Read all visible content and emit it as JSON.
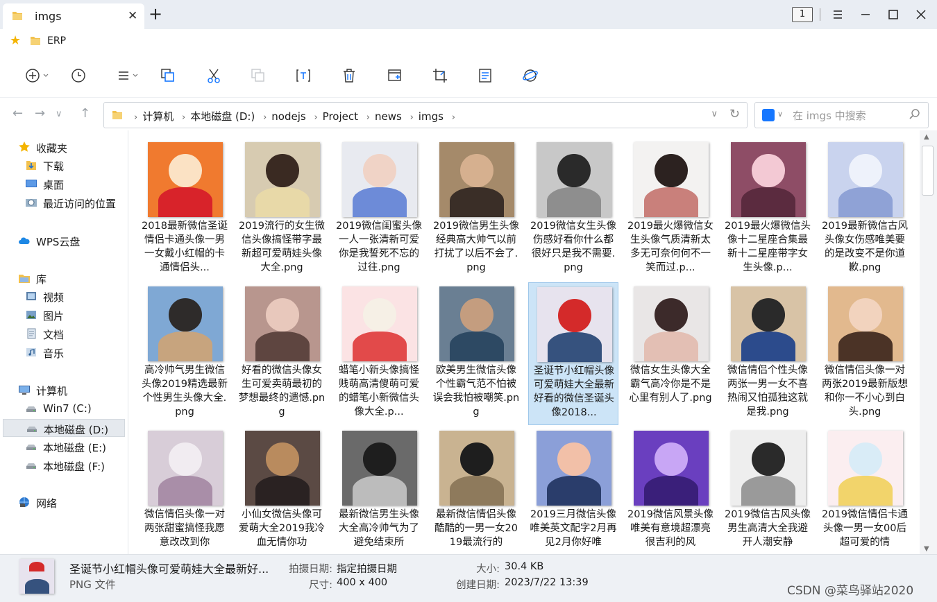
{
  "window": {
    "tab_title": "imgs",
    "tab_close": "✕",
    "new_tab": "+",
    "window_count": "1"
  },
  "bookmarks": {
    "items": [
      {
        "label": "ERP"
      }
    ]
  },
  "navigation": {
    "breadcrumb": [
      "计算机",
      "本地磁盘 (D:)",
      "nodejs",
      "Project",
      "news",
      "imgs"
    ],
    "search_placeholder": "在 imgs 中搜索"
  },
  "sidebar": {
    "items": [
      {
        "label": "收藏夹",
        "icon": "star-icon"
      },
      {
        "label": "下载",
        "icon": "download-folder-icon"
      },
      {
        "label": "桌面",
        "icon": "desktop-icon"
      },
      {
        "label": "最近访问的位置",
        "icon": "recent-places-icon"
      },
      {
        "label": "WPS云盘",
        "icon": "cloud-icon"
      },
      {
        "label": "库",
        "icon": "library-icon"
      },
      {
        "label": "视频",
        "icon": "video-icon"
      },
      {
        "label": "图片",
        "icon": "pictures-icon"
      },
      {
        "label": "文档",
        "icon": "documents-icon"
      },
      {
        "label": "音乐",
        "icon": "music-icon"
      },
      {
        "label": "计算机",
        "icon": "computer-icon"
      },
      {
        "label": "Win7 (C:)",
        "icon": "drive-icon"
      },
      {
        "label": "本地磁盘 (D:)",
        "icon": "drive-icon",
        "selected": true
      },
      {
        "label": "本地磁盘 (E:)",
        "icon": "drive-icon"
      },
      {
        "label": "本地磁盘 (F:)",
        "icon": "drive-icon"
      },
      {
        "label": "网络",
        "icon": "network-icon"
      }
    ]
  },
  "files": [
    {
      "name": "2018最新微信圣诞情侣卡通头像一男一女戴小红帽的卡通情侣头...",
      "colors": [
        "#f07a2f",
        "#fbe2c4",
        "#d8232a"
      ]
    },
    {
      "name": "2019流行的女生微信头像搞怪带字最新超可爱萌娃头像大全.png",
      "colors": [
        "#d7cbb1",
        "#3a2a22",
        "#e8d9a8"
      ]
    },
    {
      "name": "2019微信闺蜜头像一人一张清新可爱你是我誓死不忘的过往.png",
      "colors": [
        "#e8eaf0",
        "#f0d3c6",
        "#6d8bd8"
      ]
    },
    {
      "name": "2019微信男生头像经典高大帅气以前打扰了以后不会了.png",
      "colors": [
        "#a58a6a",
        "#d6b08f",
        "#3a2e27"
      ]
    },
    {
      "name": "2019微信女生头像伤感好看你什么都很好只是我不需要.png",
      "colors": [
        "#c8c8c8",
        "#2a2a2a",
        "#8e8e8e"
      ]
    },
    {
      "name": "2019最火爆微信女生头像气质清新太多无可奈何何不一笑而过.p...",
      "colors": [
        "#f3f2f1",
        "#2c2220",
        "#c9807b"
      ]
    },
    {
      "name": "2019最火爆微信头像十二星座合集最新十二星座带字女生头像.p...",
      "colors": [
        "#8e4d66",
        "#f3c9d4",
        "#5b2b3f"
      ]
    },
    {
      "name": "2019最新微信古风头像女伤感唯美要的是改变不是你道歉.png",
      "colors": [
        "#c9d3ee",
        "#eef2fb",
        "#8fa2d6"
      ]
    },
    {
      "name": "高冷帅气男生微信头像2019精选最新个性男生头像大全.png",
      "colors": [
        "#7fa8d4",
        "#2e2b2a",
        "#c7a47e"
      ]
    },
    {
      "name": "好看的微信头像女生可爱卖萌最初的梦想最终的遗憾.png",
      "colors": [
        "#b8968e",
        "#e8c8bc",
        "#5e4540"
      ]
    },
    {
      "name": "蜡笔小新头像搞怪贱萌高清傻萌可爱的蜡笔小新微信头像大全.p...",
      "colors": [
        "#fbe3e4",
        "#f6f0e6",
        "#e24a4a"
      ]
    },
    {
      "name": "欧美男生微信头像个性霸气范不怕被误会我怕被嘲笑.png",
      "colors": [
        "#6a7f93",
        "#c49d7f",
        "#2d4963"
      ]
    },
    {
      "name": "圣诞节小红帽头像可爱萌娃大全最新好看的微信圣诞头像2018...",
      "colors": [
        "#e7e3ee",
        "#d42a2a",
        "#36527e"
      ]
    },
    {
      "name": "微信女生头像大全霸气高冷你是不是心里有别人了.png",
      "colors": [
        "#e9e6e6",
        "#3c2a2a",
        "#e3bfb4"
      ]
    },
    {
      "name": "微信情侣个性头像两张一男一女不喜热闹又怕孤独这就是我.png",
      "colors": [
        "#d8c3a6",
        "#2a2a2a",
        "#2c4b8c"
      ]
    },
    {
      "name": "微信情侣头像一对两张2019最新版想和你一不小心到白头.png",
      "colors": [
        "#e2b98e",
        "#f2d3be",
        "#4b3326"
      ]
    },
    {
      "name": "微信情侣头像一对两张甜蜜搞怪我愿意改改到你",
      "colors": [
        "#d8cdd8",
        "#f1ecf1",
        "#a98ea8"
      ]
    },
    {
      "name": "小仙女微信头像可爱萌大全2019我冷血无情你功",
      "colors": [
        "#5b4a44",
        "#b98b5e",
        "#2a2222"
      ]
    },
    {
      "name": "最新微信男生头像大全高冷帅气为了避免结束所",
      "colors": [
        "#6a6a6a",
        "#1e1e1e",
        "#bcbcbc"
      ]
    },
    {
      "name": "最新微信情侣头像酷酷的一男一女2019最流行的",
      "colors": [
        "#c9b391",
        "#1e1e1e",
        "#8e7a5c"
      ]
    },
    {
      "name": "2019三月微信头像唯美英文配字2月再见2月你好唯",
      "colors": [
        "#8b9fd8",
        "#f2c0a8",
        "#2a3d6b"
      ]
    },
    {
      "name": "2019微信风景头像唯美有意境超漂亮很吉利的风",
      "colors": [
        "#6a3fbf",
        "#c8a6f5",
        "#3a1f7a"
      ]
    },
    {
      "name": "2019微信古风头像男生高清大全我避开人潮安静",
      "colors": [
        "#eeeeee",
        "#2a2a2a",
        "#9a9a9a"
      ]
    },
    {
      "name": "2019微信情侣卡通头像一男一女00后超可爱的情",
      "colors": [
        "#fbeef0",
        "#d9ecf7",
        "#f2d46b"
      ]
    }
  ],
  "details": {
    "name": "圣诞节小红帽头像可爱萌娃大全最新好...",
    "type": "PNG 文件",
    "date_taken_label": "拍摄日期:",
    "date_taken_value": "指定拍摄日期",
    "dimensions_label": "尺寸:",
    "dimensions_value": "400 x 400",
    "size_label": "大小:",
    "size_value": "30.4 KB",
    "created_label": "创建日期:",
    "created_value": "2023/7/22 13:39"
  },
  "watermark": "CSDN @菜鸟驿站2020"
}
